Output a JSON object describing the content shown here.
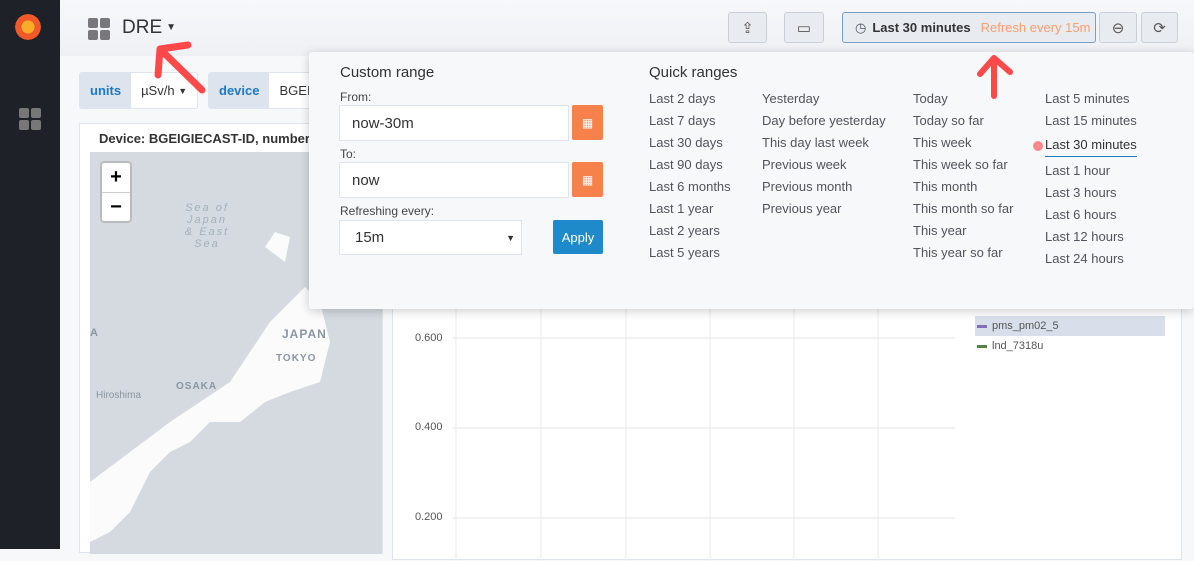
{
  "nav": {
    "dashboard_title": "DRE",
    "time_range": "Last 30 minutes",
    "refresh": "Refresh every 15m"
  },
  "variables": [
    {
      "label": "units",
      "value": "µSv/h"
    },
    {
      "label": "device",
      "value": "BGEIG"
    }
  ],
  "map_panel": {
    "title": "Device: BGEIGIECAST-ID, number of",
    "zoom_in": "+",
    "zoom_out": "−",
    "labels": {
      "sea": "Sea of Japan & East Sea",
      "japan": "JAPAN",
      "tokyo": "TOKYO",
      "osaka": "OSAKA",
      "hiroshima": "Hiroshima",
      "edge": "A"
    }
  },
  "chart_panel": {
    "yticks": [
      "0.600",
      "0.400",
      "0.200"
    ],
    "legend": [
      {
        "name": "pms_pm02_5",
        "color": "#806eb7"
      },
      {
        "name": "lnd_7318u",
        "color": "#508642"
      }
    ]
  },
  "time_picker": {
    "custom_range_title": "Custom range",
    "from_label": "From:",
    "from_value": "now-30m",
    "to_label": "To:",
    "to_value": "now",
    "refresh_label": "Refreshing every:",
    "refresh_value": "15m",
    "apply": "Apply",
    "quick_ranges_title": "Quick ranges",
    "col1": [
      "Last 2 days",
      "Last 7 days",
      "Last 30 days",
      "Last 90 days",
      "Last 6 months",
      "Last 1 year",
      "Last 2 years",
      "Last 5 years"
    ],
    "col2": [
      "Yesterday",
      "Day before yesterday",
      "This day last week",
      "Previous week",
      "Previous month",
      "Previous year"
    ],
    "col3": [
      "Today",
      "Today so far",
      "This week",
      "This week so far",
      "This month",
      "This month so far",
      "This year",
      "This year so far"
    ],
    "col4": [
      "Last 5 minutes",
      "Last 15 minutes",
      "Last 30 minutes",
      "Last 1 hour",
      "Last 3 hours",
      "Last 6 hours",
      "Last 12 hours",
      "Last 24 hours"
    ],
    "active": "Last 30 minutes"
  },
  "colors": {
    "accent": "#1f78c1",
    "refresh_text": "#f89e6c",
    "calendar_button": "#f6814a",
    "annotation": "#ff2020"
  }
}
